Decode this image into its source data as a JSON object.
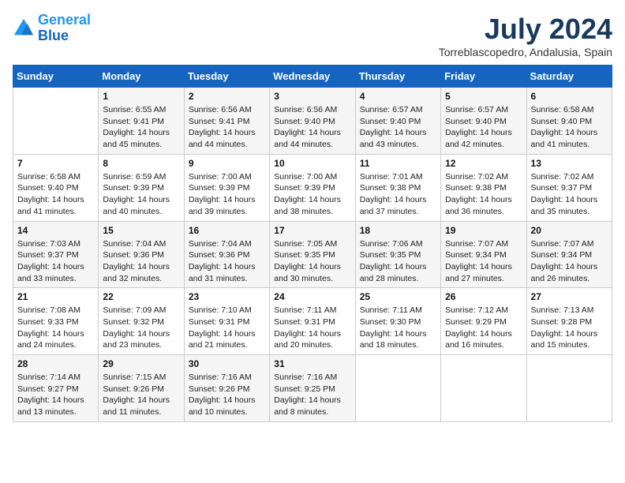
{
  "header": {
    "logo_line1": "General",
    "logo_line2": "Blue",
    "month_year": "July 2024",
    "location": "Torreblascopedro, Andalusia, Spain"
  },
  "days_of_week": [
    "Sunday",
    "Monday",
    "Tuesday",
    "Wednesday",
    "Thursday",
    "Friday",
    "Saturday"
  ],
  "weeks": [
    [
      {
        "day": "",
        "sunrise": "",
        "sunset": "",
        "daylight": ""
      },
      {
        "day": "1",
        "sunrise": "Sunrise: 6:55 AM",
        "sunset": "Sunset: 9:41 PM",
        "daylight": "Daylight: 14 hours and 45 minutes."
      },
      {
        "day": "2",
        "sunrise": "Sunrise: 6:56 AM",
        "sunset": "Sunset: 9:41 PM",
        "daylight": "Daylight: 14 hours and 44 minutes."
      },
      {
        "day": "3",
        "sunrise": "Sunrise: 6:56 AM",
        "sunset": "Sunset: 9:40 PM",
        "daylight": "Daylight: 14 hours and 44 minutes."
      },
      {
        "day": "4",
        "sunrise": "Sunrise: 6:57 AM",
        "sunset": "Sunset: 9:40 PM",
        "daylight": "Daylight: 14 hours and 43 minutes."
      },
      {
        "day": "5",
        "sunrise": "Sunrise: 6:57 AM",
        "sunset": "Sunset: 9:40 PM",
        "daylight": "Daylight: 14 hours and 42 minutes."
      },
      {
        "day": "6",
        "sunrise": "Sunrise: 6:58 AM",
        "sunset": "Sunset: 9:40 PM",
        "daylight": "Daylight: 14 hours and 41 minutes."
      }
    ],
    [
      {
        "day": "7",
        "sunrise": "Sunrise: 6:58 AM",
        "sunset": "Sunset: 9:40 PM",
        "daylight": "Daylight: 14 hours and 41 minutes."
      },
      {
        "day": "8",
        "sunrise": "Sunrise: 6:59 AM",
        "sunset": "Sunset: 9:39 PM",
        "daylight": "Daylight: 14 hours and 40 minutes."
      },
      {
        "day": "9",
        "sunrise": "Sunrise: 7:00 AM",
        "sunset": "Sunset: 9:39 PM",
        "daylight": "Daylight: 14 hours and 39 minutes."
      },
      {
        "day": "10",
        "sunrise": "Sunrise: 7:00 AM",
        "sunset": "Sunset: 9:39 PM",
        "daylight": "Daylight: 14 hours and 38 minutes."
      },
      {
        "day": "11",
        "sunrise": "Sunrise: 7:01 AM",
        "sunset": "Sunset: 9:38 PM",
        "daylight": "Daylight: 14 hours and 37 minutes."
      },
      {
        "day": "12",
        "sunrise": "Sunrise: 7:02 AM",
        "sunset": "Sunset: 9:38 PM",
        "daylight": "Daylight: 14 hours and 36 minutes."
      },
      {
        "day": "13",
        "sunrise": "Sunrise: 7:02 AM",
        "sunset": "Sunset: 9:37 PM",
        "daylight": "Daylight: 14 hours and 35 minutes."
      }
    ],
    [
      {
        "day": "14",
        "sunrise": "Sunrise: 7:03 AM",
        "sunset": "Sunset: 9:37 PM",
        "daylight": "Daylight: 14 hours and 33 minutes."
      },
      {
        "day": "15",
        "sunrise": "Sunrise: 7:04 AM",
        "sunset": "Sunset: 9:36 PM",
        "daylight": "Daylight: 14 hours and 32 minutes."
      },
      {
        "day": "16",
        "sunrise": "Sunrise: 7:04 AM",
        "sunset": "Sunset: 9:36 PM",
        "daylight": "Daylight: 14 hours and 31 minutes."
      },
      {
        "day": "17",
        "sunrise": "Sunrise: 7:05 AM",
        "sunset": "Sunset: 9:35 PM",
        "daylight": "Daylight: 14 hours and 30 minutes."
      },
      {
        "day": "18",
        "sunrise": "Sunrise: 7:06 AM",
        "sunset": "Sunset: 9:35 PM",
        "daylight": "Daylight: 14 hours and 28 minutes."
      },
      {
        "day": "19",
        "sunrise": "Sunrise: 7:07 AM",
        "sunset": "Sunset: 9:34 PM",
        "daylight": "Daylight: 14 hours and 27 minutes."
      },
      {
        "day": "20",
        "sunrise": "Sunrise: 7:07 AM",
        "sunset": "Sunset: 9:34 PM",
        "daylight": "Daylight: 14 hours and 26 minutes."
      }
    ],
    [
      {
        "day": "21",
        "sunrise": "Sunrise: 7:08 AM",
        "sunset": "Sunset: 9:33 PM",
        "daylight": "Daylight: 14 hours and 24 minutes."
      },
      {
        "day": "22",
        "sunrise": "Sunrise: 7:09 AM",
        "sunset": "Sunset: 9:32 PM",
        "daylight": "Daylight: 14 hours and 23 minutes."
      },
      {
        "day": "23",
        "sunrise": "Sunrise: 7:10 AM",
        "sunset": "Sunset: 9:31 PM",
        "daylight": "Daylight: 14 hours and 21 minutes."
      },
      {
        "day": "24",
        "sunrise": "Sunrise: 7:11 AM",
        "sunset": "Sunset: 9:31 PM",
        "daylight": "Daylight: 14 hours and 20 minutes."
      },
      {
        "day": "25",
        "sunrise": "Sunrise: 7:11 AM",
        "sunset": "Sunset: 9:30 PM",
        "daylight": "Daylight: 14 hours and 18 minutes."
      },
      {
        "day": "26",
        "sunrise": "Sunrise: 7:12 AM",
        "sunset": "Sunset: 9:29 PM",
        "daylight": "Daylight: 14 hours and 16 minutes."
      },
      {
        "day": "27",
        "sunrise": "Sunrise: 7:13 AM",
        "sunset": "Sunset: 9:28 PM",
        "daylight": "Daylight: 14 hours and 15 minutes."
      }
    ],
    [
      {
        "day": "28",
        "sunrise": "Sunrise: 7:14 AM",
        "sunset": "Sunset: 9:27 PM",
        "daylight": "Daylight: 14 hours and 13 minutes."
      },
      {
        "day": "29",
        "sunrise": "Sunrise: 7:15 AM",
        "sunset": "Sunset: 9:26 PM",
        "daylight": "Daylight: 14 hours and 11 minutes."
      },
      {
        "day": "30",
        "sunrise": "Sunrise: 7:16 AM",
        "sunset": "Sunset: 9:26 PM",
        "daylight": "Daylight: 14 hours and 10 minutes."
      },
      {
        "day": "31",
        "sunrise": "Sunrise: 7:16 AM",
        "sunset": "Sunset: 9:25 PM",
        "daylight": "Daylight: 14 hours and 8 minutes."
      },
      {
        "day": "",
        "sunrise": "",
        "sunset": "",
        "daylight": ""
      },
      {
        "day": "",
        "sunrise": "",
        "sunset": "",
        "daylight": ""
      },
      {
        "day": "",
        "sunrise": "",
        "sunset": "",
        "daylight": ""
      }
    ]
  ]
}
